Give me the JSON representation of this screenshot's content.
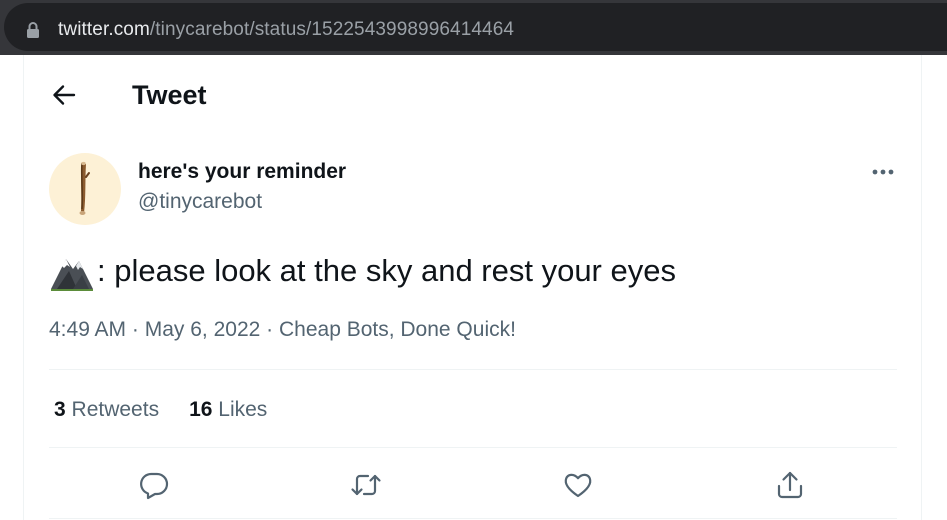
{
  "browser": {
    "url_host": "twitter.com",
    "url_path": "/tinycarebot/status/1522543998996414464",
    "icons": {
      "lock": "lock-icon"
    }
  },
  "header": {
    "title": "Tweet",
    "back_icon": "arrow-left-icon"
  },
  "tweet": {
    "display_name": "here's your reminder",
    "handle": "@tinycarebot",
    "emoji": "mountain-emoji",
    "text": ": please look at the sky and rest your eyes",
    "time": "4:49 AM",
    "sep1": " · ",
    "date": "May 6, 2022",
    "sep2": " · ",
    "source": "Cheap Bots, Done Quick!",
    "more_icon": "ellipsis-icon"
  },
  "stats": {
    "retweets_count": "3",
    "retweets_label": "Retweets",
    "likes_count": "16",
    "likes_label": "Likes"
  },
  "actions": {
    "reply": "reply-icon",
    "retweet": "retweet-icon",
    "like": "heart-icon",
    "share": "share-icon"
  },
  "colors": {
    "text": "#0f1419",
    "secondary": "#536471",
    "divider": "#eff3f4",
    "browser_bar": "#35363a",
    "url_pill": "#202124"
  }
}
